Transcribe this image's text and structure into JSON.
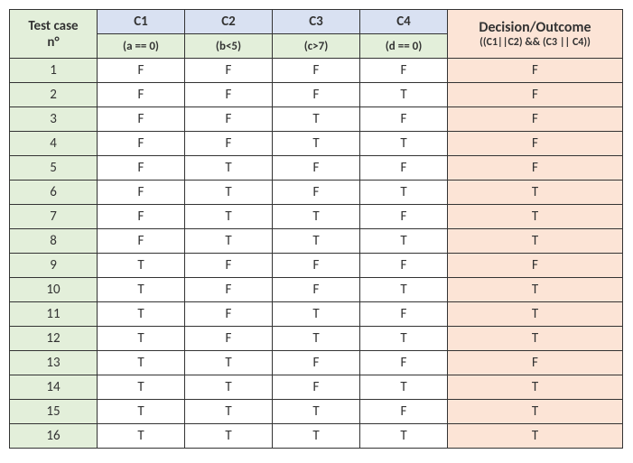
{
  "header": {
    "test_case_label_line1": "Test case",
    "test_case_label_line2": "n°",
    "c1": "C1",
    "c1_expr": "(a == 0)",
    "c2": "C2",
    "c2_expr": "(b<5)",
    "c3": "C3",
    "c3_expr": "(c>7)",
    "c4": "C4",
    "c4_expr": "(d == 0)",
    "outcome_title": "Decision/Outcome",
    "outcome_expr": "((C1||C2) && (C3 || C4))"
  },
  "chart_data": {
    "type": "table",
    "columns": [
      "Test case n°",
      "C1 (a == 0)",
      "C2 (b<5)",
      "C3 (c>7)",
      "C4 (d == 0)",
      "Decision/Outcome"
    ],
    "rows": [
      {
        "n": "1",
        "c1": "F",
        "c2": "F",
        "c3": "F",
        "c4": "F",
        "out": "F"
      },
      {
        "n": "2",
        "c1": "F",
        "c2": "F",
        "c3": "F",
        "c4": "T",
        "out": "F"
      },
      {
        "n": "3",
        "c1": "F",
        "c2": "F",
        "c3": "T",
        "c4": "F",
        "out": "F"
      },
      {
        "n": "4",
        "c1": "F",
        "c2": "F",
        "c3": "T",
        "c4": "T",
        "out": "F"
      },
      {
        "n": "5",
        "c1": "F",
        "c2": "T",
        "c3": "F",
        "c4": "F",
        "out": "F"
      },
      {
        "n": "6",
        "c1": "F",
        "c2": "T",
        "c3": "F",
        "c4": "T",
        "out": "T"
      },
      {
        "n": "7",
        "c1": "F",
        "c2": "T",
        "c3": "T",
        "c4": "F",
        "out": "T"
      },
      {
        "n": "8",
        "c1": "F",
        "c2": "T",
        "c3": "T",
        "c4": "T",
        "out": "T"
      },
      {
        "n": "9",
        "c1": "T",
        "c2": "F",
        "c3": "F",
        "c4": "F",
        "out": "F"
      },
      {
        "n": "10",
        "c1": "T",
        "c2": "F",
        "c3": "F",
        "c4": "T",
        "out": "T"
      },
      {
        "n": "11",
        "c1": "T",
        "c2": "F",
        "c3": "T",
        "c4": "F",
        "out": "T"
      },
      {
        "n": "12",
        "c1": "T",
        "c2": "F",
        "c3": "T",
        "c4": "T",
        "out": "T"
      },
      {
        "n": "13",
        "c1": "T",
        "c2": "T",
        "c3": "F",
        "c4": "F",
        "out": "F"
      },
      {
        "n": "14",
        "c1": "T",
        "c2": "T",
        "c3": "F",
        "c4": "T",
        "out": "T"
      },
      {
        "n": "15",
        "c1": "T",
        "c2": "T",
        "c3": "T",
        "c4": "F",
        "out": "T"
      },
      {
        "n": "16",
        "c1": "T",
        "c2": "T",
        "c3": "T",
        "c4": "T",
        "out": "T"
      }
    ]
  }
}
